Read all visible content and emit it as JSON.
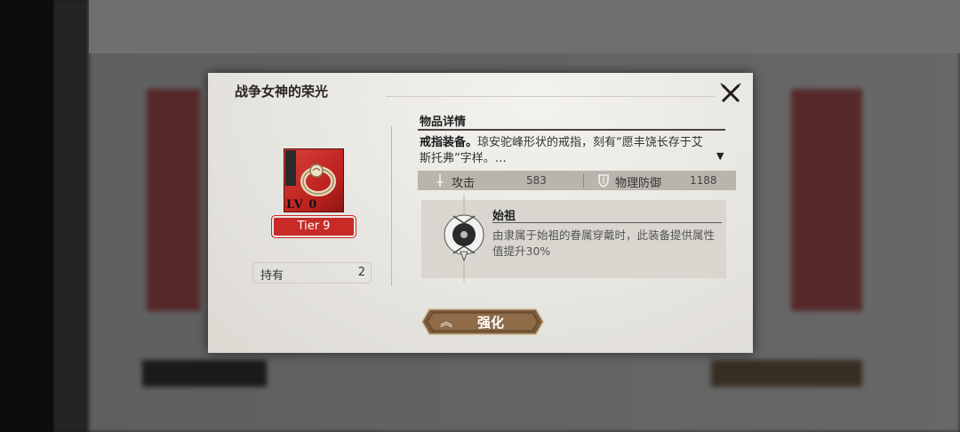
{
  "dialog": {
    "title": "战争女神的荣光",
    "close_icon": "close-icon"
  },
  "item": {
    "level": "LV 0",
    "tier": "Tier 9",
    "owned_label": "持有",
    "owned_value": "2",
    "icon": "ring-icon",
    "rarity_color": "#c82a26"
  },
  "details": {
    "section_title": "物品详情",
    "desc_bold": "戒指装备。",
    "desc_text": "琼安驼峰形状的戒指，刻有“愿丰饶长存于艾斯托弗”字样。…",
    "more_icon": "expand-down-icon",
    "stats": [
      {
        "icon": "sword-icon",
        "label": "攻击",
        "value": "583"
      },
      {
        "icon": "shield-icon",
        "label": "物理防御",
        "value": "1188"
      }
    ]
  },
  "skill": {
    "title": "始祖",
    "desc": "由隶属于始祖的眷属穿戴时，此装备提供属性值提升30%",
    "icon": "ancestor-emblem-icon"
  },
  "actions": {
    "enhance_label": "强化",
    "enhance_icon": "double-chevron-up-icon",
    "accent": "#7a5a3a"
  }
}
